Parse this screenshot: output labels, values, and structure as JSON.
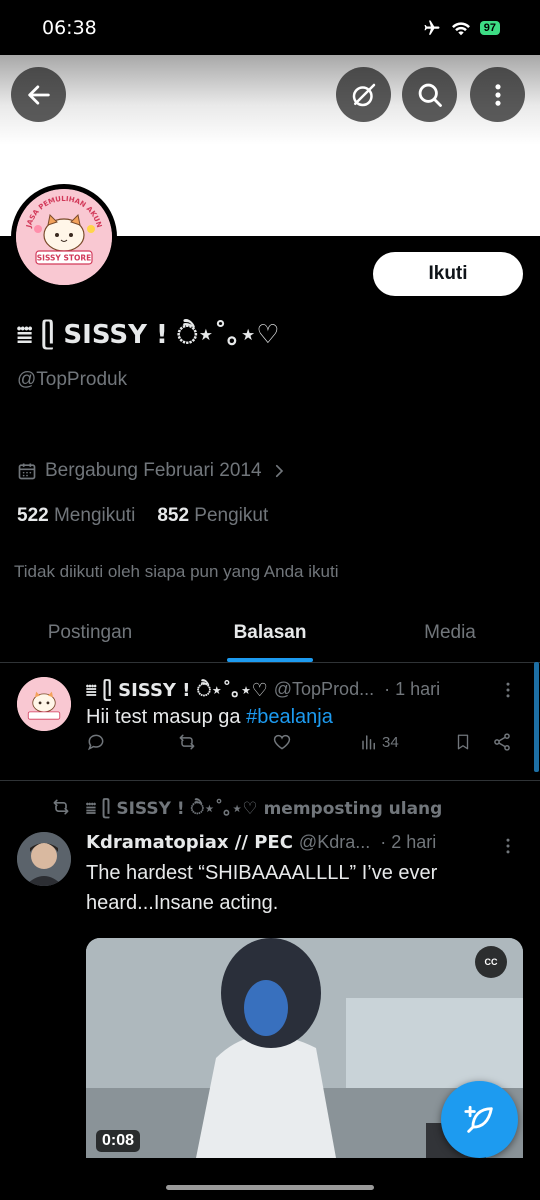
{
  "status_bar": {
    "time": "06:38",
    "battery": "97"
  },
  "header": {
    "back_icon": "arrow-left-icon",
    "grok_icon": "slash-circle-icon",
    "search_icon": "search-icon",
    "more_icon": "more-vertical-icon"
  },
  "profile": {
    "avatar_text_top": "JASA PEMULIHAN AKUN",
    "avatar_text_bottom": "SISSY STORE",
    "follow_label": "Ikuti",
    "display_name": "⩸ ᥫ SISSY ! ੈ⋆˚｡⋆♡",
    "handle": "@TopProduk",
    "joined": "Bergabung Februari 2014",
    "following_count": "522",
    "following_label": "Mengikuti",
    "followers_count": "852",
    "followers_label": "Pengikut",
    "not_followed_text": "Tidak diikuti oleh siapa pun yang Anda ikuti"
  },
  "tabs": [
    {
      "label": "Postingan",
      "active": false
    },
    {
      "label": "Balasan",
      "active": true
    },
    {
      "label": "Media",
      "active": false
    }
  ],
  "posts": [
    {
      "name": "⩸ ᥫ SISSY ! ੈ⋆˚｡⋆♡",
      "handle": "@TopProd...",
      "time": "· 1 hari",
      "text": "Hii test masup ga ",
      "hashtag": "#bealanja",
      "views": "34"
    },
    {
      "repost_by": "⩸ ᥫ SISSY ! ੈ⋆˚｡⋆♡ memposting ulang",
      "name": "Kdramatopiax // PEC",
      "handle": "@Kdra...",
      "time": "· 2 hari",
      "text": "The hardest “SHIBAAAALLLL” I’ve ever heard...Insane acting.",
      "video_duration": "0:08",
      "cc_label": "CC"
    }
  ],
  "colors": {
    "accent": "#1d9bf0",
    "background": "#000000",
    "text": "#e7e9ea",
    "muted": "#71767b"
  }
}
